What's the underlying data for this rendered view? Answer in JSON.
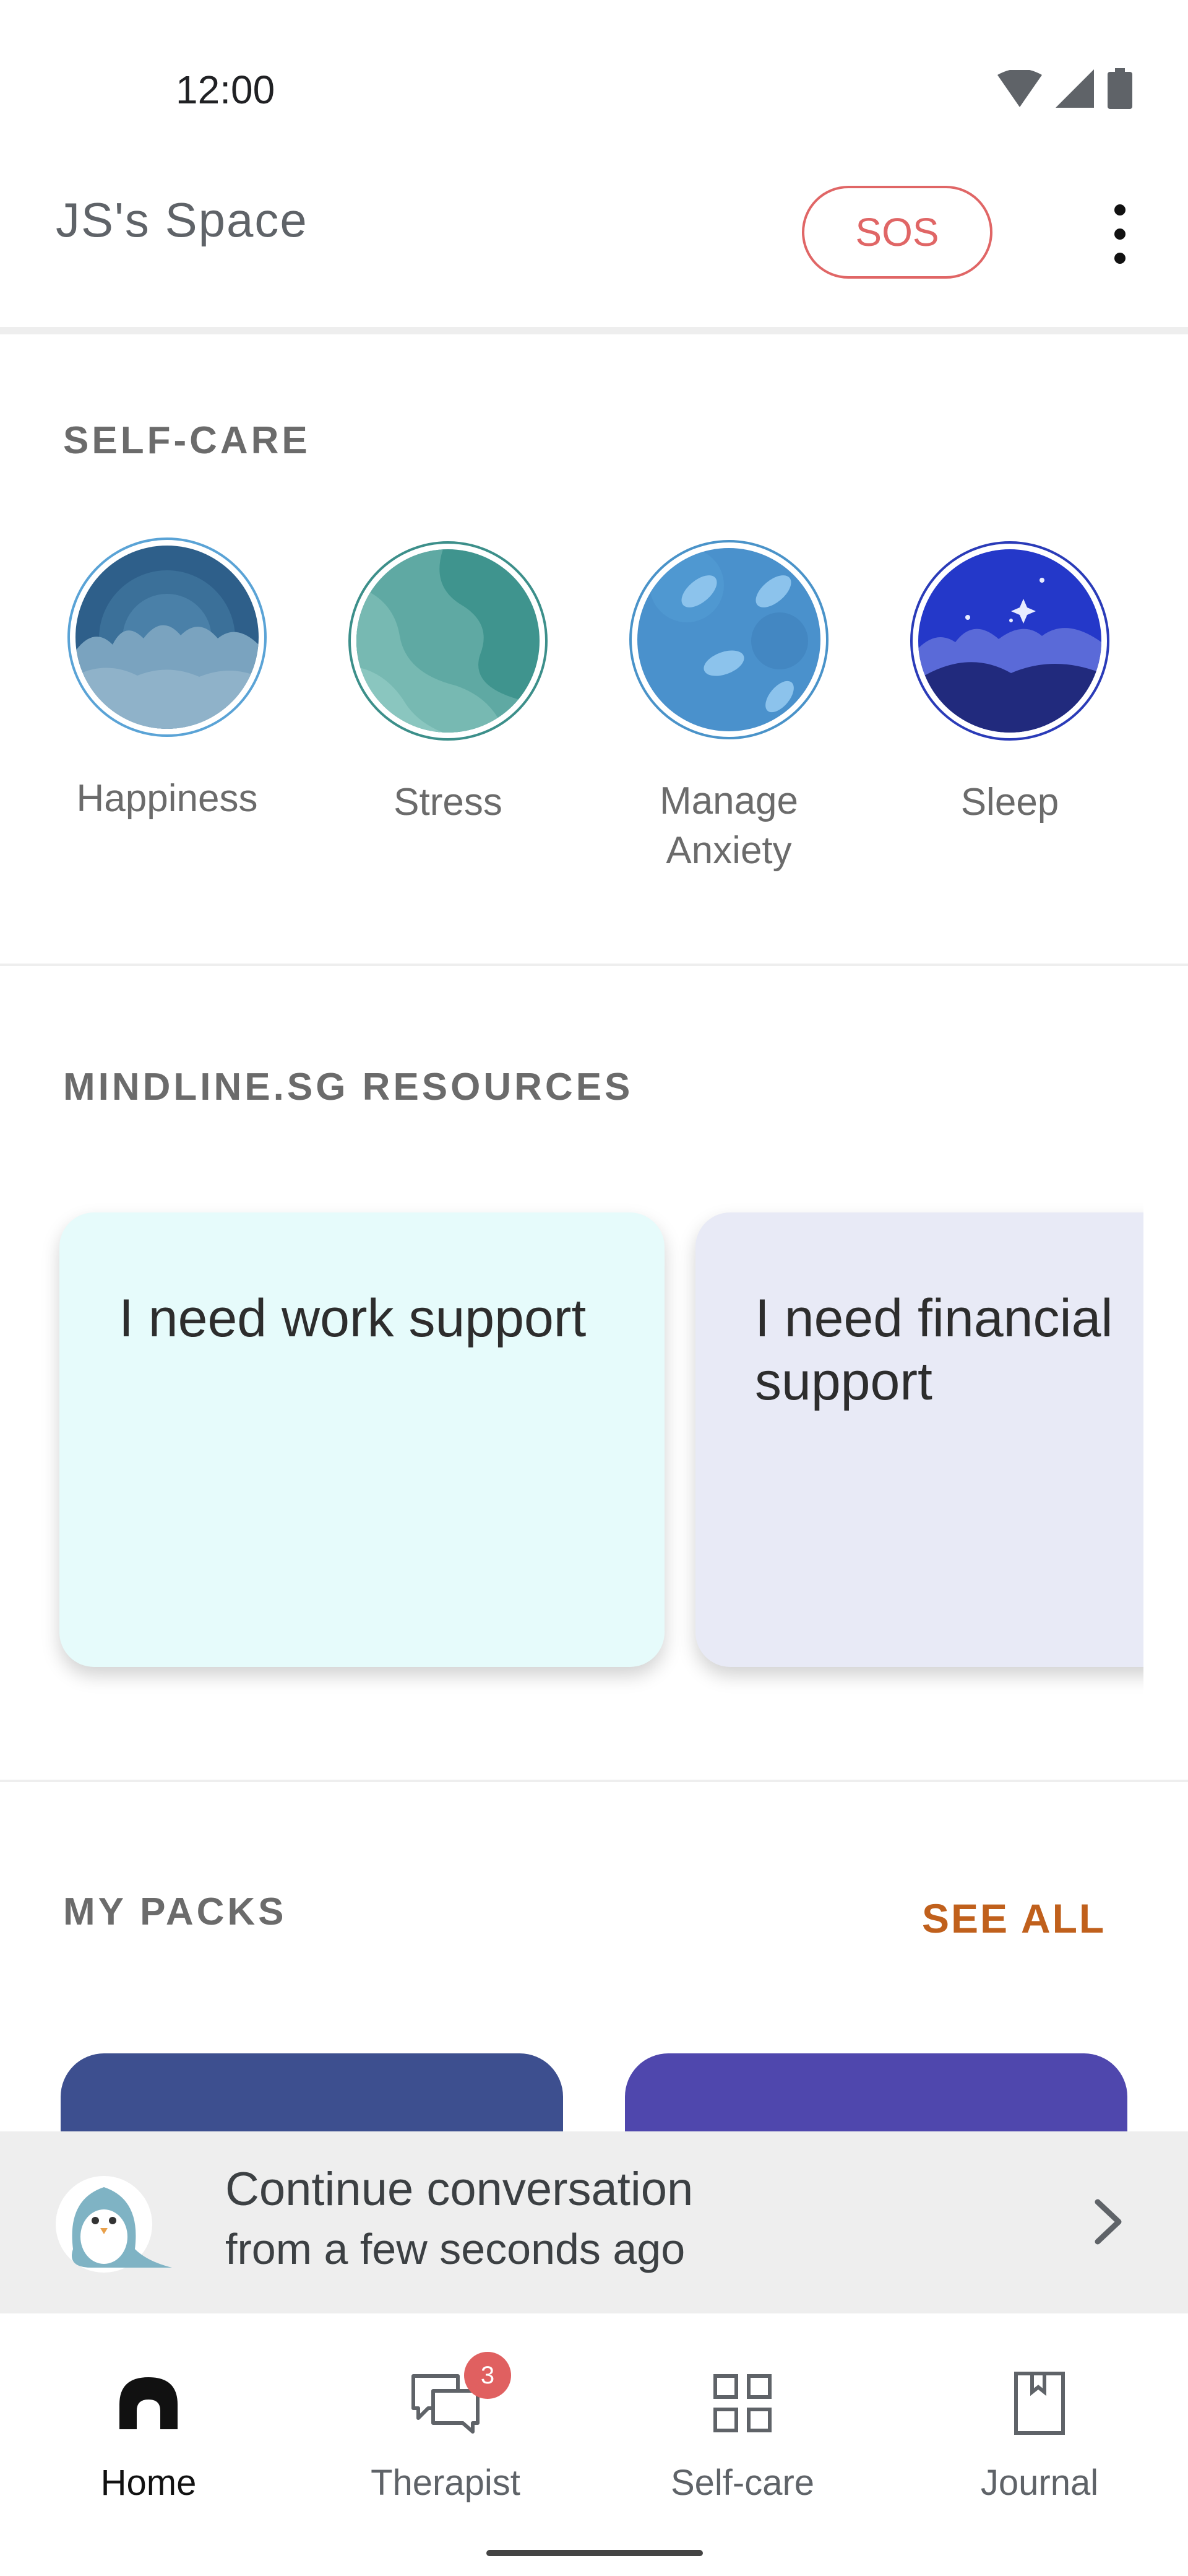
{
  "status_bar": {
    "time": "12:00"
  },
  "app_bar": {
    "title": "JS's Space",
    "sos_label": "SOS"
  },
  "self_care": {
    "header": "SELF-CARE",
    "items": [
      {
        "label": "Happiness"
      },
      {
        "label": "Stress"
      },
      {
        "label": "Manage\nAnxiety"
      },
      {
        "label": "Sleep"
      }
    ]
  },
  "resources": {
    "header": "MINDLINE.SG RESOURCES",
    "cards": [
      {
        "title": "I need work support",
        "color": "#e6fbfb"
      },
      {
        "title": "I need financial support",
        "color": "#e8eaf6"
      }
    ]
  },
  "packs": {
    "header": "MY PACKS",
    "see_all": "SEE ALL",
    "card_colors": [
      "#3d4f8f",
      "#4f47ad"
    ]
  },
  "continue": {
    "line1": "Continue conversation",
    "line2": "from a few seconds ago"
  },
  "nav": {
    "items": [
      {
        "label": "Home",
        "icon": "home-icon",
        "active": true
      },
      {
        "label": "Therapist",
        "icon": "chat-icon",
        "badge": "3"
      },
      {
        "label": "Self-care",
        "icon": "grid-icon"
      },
      {
        "label": "Journal",
        "icon": "journal-icon"
      }
    ]
  },
  "colors": {
    "accent": "#c0601c",
    "sos": "#e06666",
    "badge": "#e06060"
  }
}
